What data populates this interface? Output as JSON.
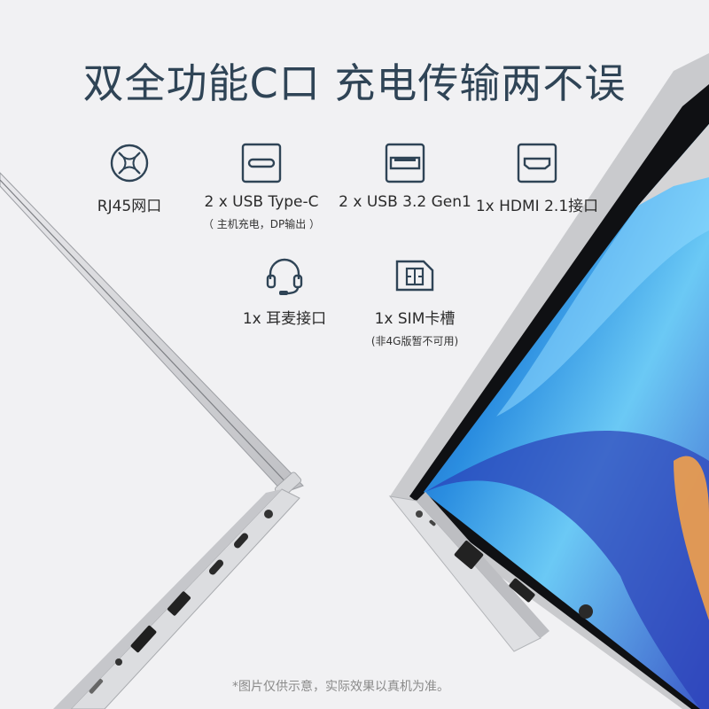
{
  "headline": "双全功能C口 充电传输两不误",
  "ports": [
    {
      "icon": "rj45-icon",
      "label": "RJ45网口",
      "note": ""
    },
    {
      "icon": "usb-c-icon",
      "label": "2 x USB Type-C",
      "note": "（ 主机充电，DP输出 ）"
    },
    {
      "icon": "usb-a-icon",
      "label": "2 x USB 3.2 Gen1",
      "note": ""
    },
    {
      "icon": "hdmi-icon",
      "label": "1x HDMI 2.1接口",
      "note": ""
    },
    {
      "icon": "headset-icon",
      "label": "1x 耳麦接口",
      "note": ""
    },
    {
      "icon": "sim-card-icon",
      "label": "1x SIM卡槽",
      "note": "(非4G版暂不可用)"
    }
  ],
  "footnote": "*图片仅供示意，实际效果以真机为准。",
  "colors": {
    "headline": "#2f4456",
    "icon": "#2f4456",
    "background": "#f1f1f3"
  }
}
